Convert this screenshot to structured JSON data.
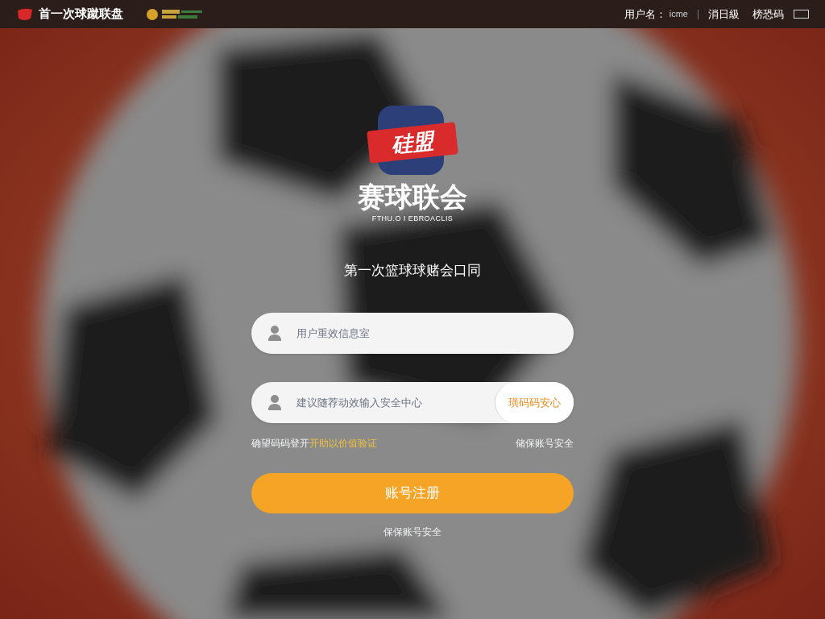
{
  "top_bar": {
    "brand": "首一次球蹴联盘",
    "user_label": "用户名：",
    "user_value": "icme",
    "links": [
      "消日級",
      "榜恐码"
    ]
  },
  "logo": {
    "badge_text": "硅盟",
    "title": "赛球联会",
    "subtitle": "FTHU.O I EBROACLIS"
  },
  "heading": "第一次篮球球赌会口同",
  "fields": [
    {
      "kind": "plain",
      "placeholder": "用户重效信息室"
    },
    {
      "kind": "with_button",
      "placeholder": "建议随荐动效输入安全中心",
      "button": "璜码码安心"
    }
  ],
  "notes": {
    "text": "确望码码登开",
    "link": "开助以价值验证",
    "right_link": "储保账号安全"
  },
  "register_button": "账号注册",
  "footer_link": "保保账号安全"
}
